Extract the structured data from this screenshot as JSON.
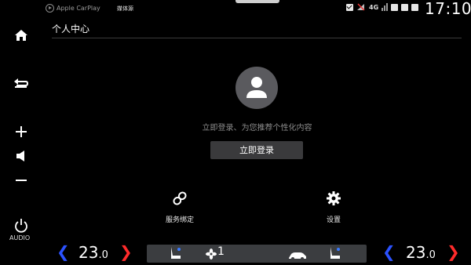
{
  "status_bar": {
    "source_carplay": "Apple CarPlay",
    "source_media": "媒体源",
    "network": "4G",
    "clock": "17:10"
  },
  "sidebar": {
    "audio_label": "AUDIO"
  },
  "page": {
    "title": "个人中心",
    "login_prompt": "立即登录、为您推荐个性化内容",
    "login_button": "立即登录",
    "quick_actions": [
      {
        "label": "服务绑定",
        "icon": "link-icon"
      },
      {
        "label": "设置",
        "icon": "gear-icon"
      }
    ]
  },
  "climate": {
    "left_temp": "23",
    "left_temp_decimal": ".0",
    "right_temp": "23",
    "right_temp_decimal": ".0",
    "fan_level": "1",
    "colors": {
      "decrease": "#2b52ff",
      "increase": "#ff2b2b"
    }
  }
}
